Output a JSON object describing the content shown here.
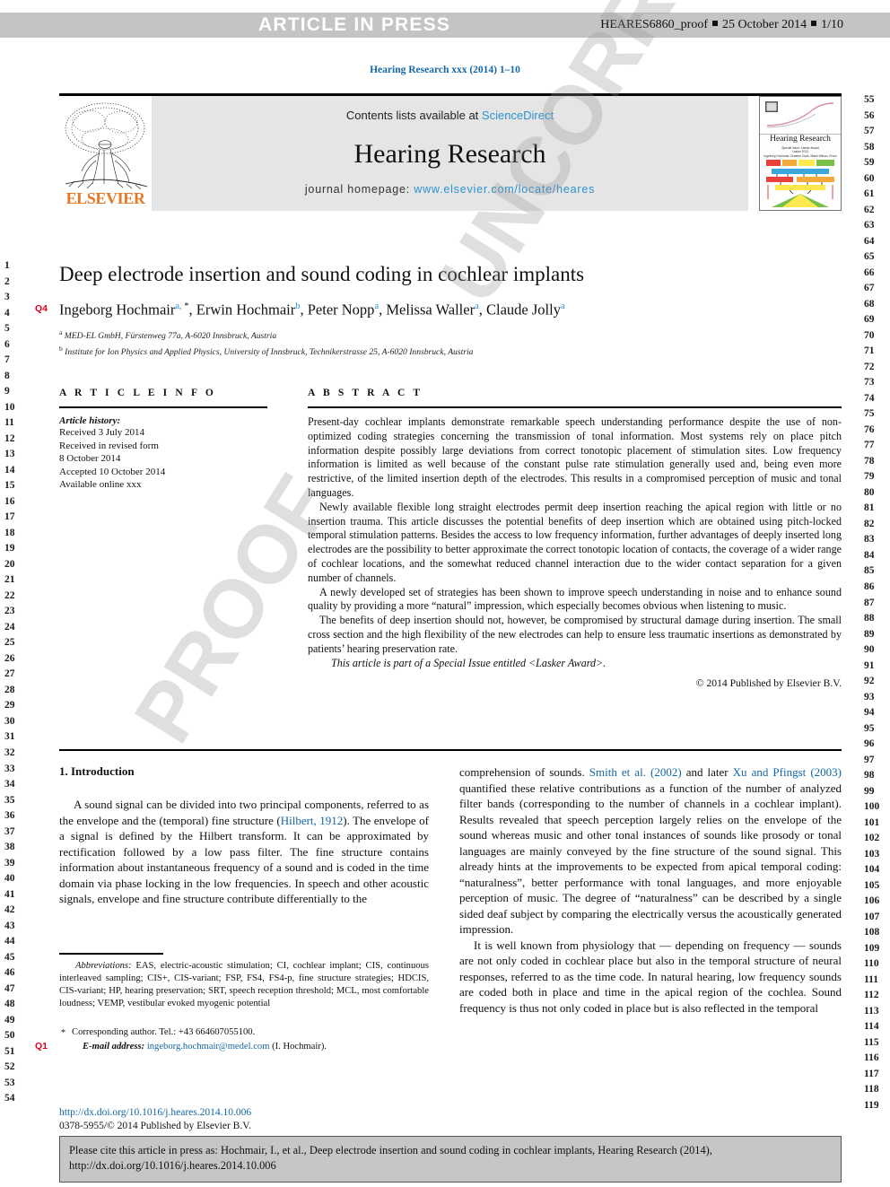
{
  "proof_banner": {
    "label": "ARTICLE IN PRESS",
    "proof_id": "HEARES6860_proof",
    "date": "25 October 2014",
    "page": "1/10"
  },
  "journal_ref": "Hearing Research xxx (2014) 1–10",
  "masthead": {
    "publisher": "ELSEVIER",
    "contents_prefix": "Contents lists available at ",
    "contents_link": "ScienceDirect",
    "journal_title": "Hearing Research",
    "homepage_prefix": "journal homepage: ",
    "homepage_url": "www.elsevier.com/locate/heares",
    "cover_title": "Hearing Research",
    "cover_subtitle": "Special Issue: Lasker Award\nLasker 2013\nIngeborg Hochmair, Graeme Clark, Blake Wilson, Erwin Hochmair, Michael Merzenich"
  },
  "article": {
    "title": "Deep electrode insertion and sound coding in cochlear implants",
    "query_marks": {
      "q4": "Q4",
      "q1": "Q1"
    },
    "authors": [
      {
        "name": "Ingeborg Hochmair",
        "marks": "a, *"
      },
      {
        "name": "Erwin Hochmair",
        "marks": "b"
      },
      {
        "name": "Peter Nopp",
        "marks": "a"
      },
      {
        "name": "Melissa Waller",
        "marks": "a"
      },
      {
        "name": "Claude Jolly",
        "marks": "a"
      }
    ],
    "affiliations": [
      {
        "mark": "a",
        "text": "MED-EL GmbH, Fürstenweg 77a, A-6020 Innsbruck, Austria"
      },
      {
        "mark": "b",
        "text": "Institute for Ion Physics and Applied Physics, University of Innsbruck, Technikerstrasse 25, A-6020 Innsbruck, Austria"
      }
    ]
  },
  "article_info": {
    "heading": "A R T I C L E   I N F O",
    "history_label": "Article history:",
    "history": [
      "Received 3 July 2014",
      "Received in revised form",
      "8 October 2014",
      "Accepted 10 October 2014",
      "Available online xxx"
    ]
  },
  "abstract": {
    "heading": "A B S T R A C T",
    "paragraphs": [
      "Present-day cochlear implants demonstrate remarkable speech understanding performance despite the use of non-optimized coding strategies concerning the transmission of tonal information. Most systems rely on place pitch information despite possibly large deviations from correct tonotopic placement of stimulation sites. Low frequency information is limited as well because of the constant pulse rate stimulation generally used and, being even more restrictive, of the limited insertion depth of the electrodes. This results in a compromised perception of music and tonal languages.",
      "Newly available flexible long straight electrodes permit deep insertion reaching the apical region with little or no insertion trauma. This article discusses the potential benefits of deep insertion which are obtained using pitch-locked temporal stimulation patterns. Besides the access to low frequency information, further advantages of deeply inserted long electrodes are the possibility to better approximate the correct tonotopic location of contacts, the coverage of a wider range of cochlear locations, and the somewhat reduced channel interaction due to the wider contact separation for a given number of channels.",
      "A newly developed set of strategies has been shown to improve speech understanding in noise and to enhance sound quality by providing a more “natural” impression, which especially becomes obvious when listening to music.",
      "The benefits of deep insertion should not, however, be compromised by structural damage during insertion. The small cross section and the high flexibility of the new electrodes can help to ensure less traumatic insertions as demonstrated by patients’ hearing preservation rate."
    ],
    "special_issue": "This article is part of a Special Issue entitled <Lasker Award>.",
    "copyright": "© 2014 Published by Elsevier B.V."
  },
  "body": {
    "section_heading": "1. Introduction",
    "left_paragraph_parts": [
      "A sound signal can be divided into two principal components, referred to as the envelope and the (temporal) fine structure (",
      "Hilbert, 1912",
      "). The envelope of a signal is defined by the Hilbert transform. It can be approximated by rectification followed by a low pass filter. The fine structure contains information about instantaneous frequency of a sound and is coded in the time domain via phase locking in the low frequencies. In speech and other acoustic signals, envelope and fine structure contribute differentially to the"
    ],
    "right_paragraph_parts": [
      "comprehension of sounds. ",
      "Smith et al. (2002)",
      " and later ",
      "Xu and Pfingst (2003)",
      " quantified these relative contributions as a function of the number of analyzed filter bands (corresponding to the number of channels in a cochlear implant). Results revealed that speech perception largely relies on the envelope of the sound whereas music and other tonal instances of sounds like prosody or tonal languages are mainly conveyed by the fine structure of the sound signal. This already hints at the improvements to be expected from apical temporal coding: “naturalness”, better performance with tonal languages, and more enjoyable perception of music. The degree of “naturalness” can be described by a single sided deaf subject by comparing the electrically versus the acoustically generated impression."
    ],
    "right_paragraph_2": "It is well known from physiology that — depending on frequency — sounds are not only coded in cochlear place but also in the temporal structure of neural responses, referred to as the time code. In natural hearing, low frequency sounds are coded both in place and time in the apical region of the cochlea. Sound frequency is thus not only coded in place but is also reflected in the temporal"
  },
  "footnotes": {
    "abbreviations_label": "Abbreviations:",
    "abbreviations_text": " EAS, electric-acoustic stimulation; CI, cochlear implant; CIS, continuous interleaved sampling; CIS+, CIS-variant; FSP, FS4, FS4-p, fine structure strategies; HDCIS, CIS-variant; HP, hearing preservation; SRT, speech reception threshold; MCL, most comfortable loudness; VEMP, vestibular evoked myogenic potential",
    "corresponding_star": "*",
    "corresponding_text": "Corresponding author. Tel.: +43 664607055100.",
    "email_label": "E-mail address:",
    "email": "ingeborg.hochmair@medel.com",
    "email_suffix": " (I. Hochmair).",
    "doi": "http://dx.doi.org/10.1016/j.heares.2014.10.006",
    "issn_line": "0378-5955/© 2014 Published by Elsevier B.V."
  },
  "cite_footer": {
    "text": "Please cite this article in press as: Hochmair, I., et al., Deep electrode insertion and sound coding in cochlear implants, Hearing Research (2014), http://dx.doi.org/10.1016/j.heares.2014.10.006"
  },
  "line_numbers": {
    "left_start": 1,
    "left_end": 54,
    "right_start": 55,
    "right_end": 119
  },
  "watermark": {
    "text_1": "UNCORRECTED",
    "text_2": "PROOF"
  },
  "colors": {
    "link": "#1268a8",
    "science_direct": "#2b93d1",
    "elsevier_orange": "#e87722",
    "query_red": "#e0001b",
    "banner_gray": "#c4c4c4",
    "masthead_gray": "#e5e5e5",
    "footer_gray": "#c6c6c6"
  }
}
